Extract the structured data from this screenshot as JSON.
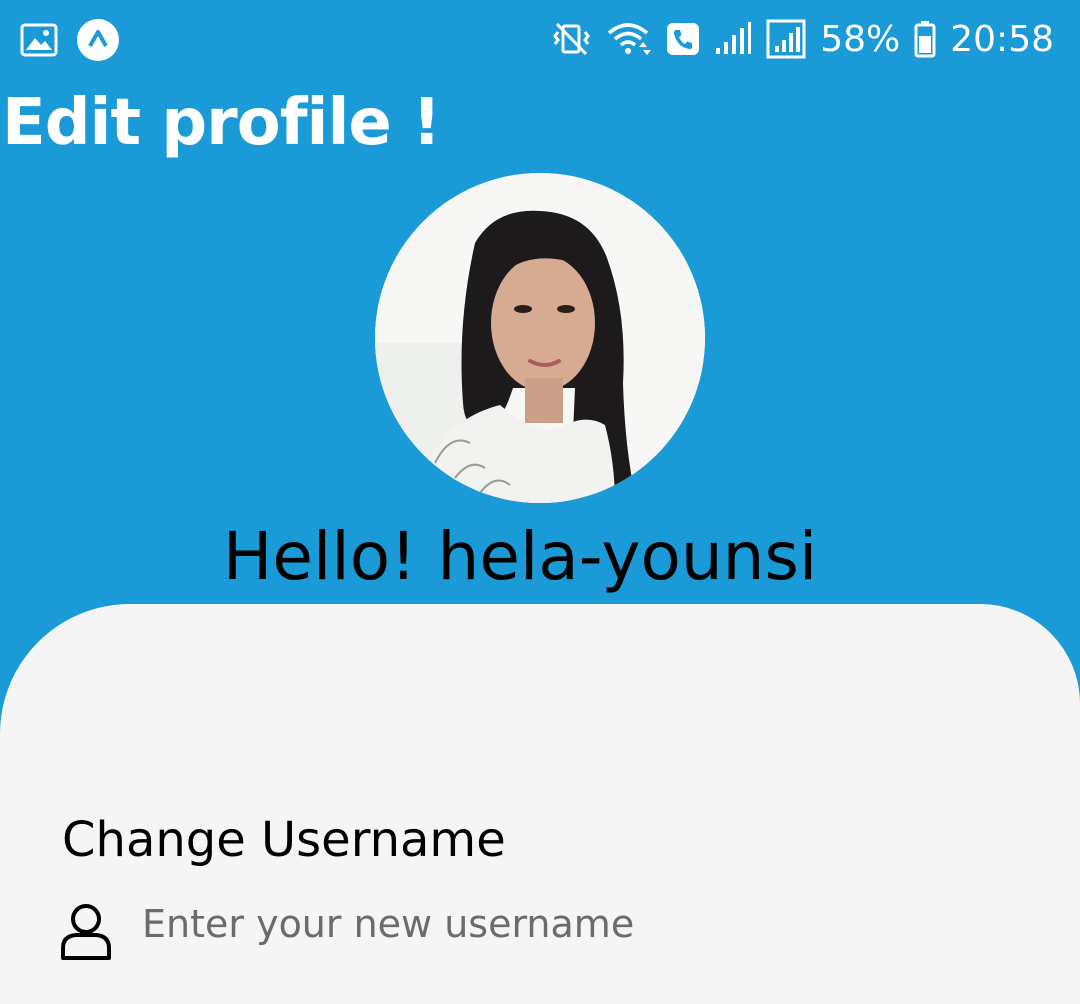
{
  "status_bar": {
    "left_icons": [
      "gallery-icon",
      "app-notification-icon"
    ],
    "right_icons": [
      "vibrate-mute-icon",
      "wifi-icon",
      "call-icon",
      "signal-icon",
      "signal-icon-2",
      "battery-icon"
    ],
    "battery_percent": "58%",
    "time": "20:58"
  },
  "header": {
    "title": "Edit profile !"
  },
  "profile": {
    "greeting": "Hello! hela-younsi"
  },
  "form": {
    "username_label": "Change Username",
    "username_placeholder": "Enter your new username",
    "username_value": ""
  },
  "colors": {
    "primary": "#1A9AD6",
    "card_background": "#F5F5F5",
    "text": "#000000",
    "placeholder": "#6B6B6B"
  }
}
